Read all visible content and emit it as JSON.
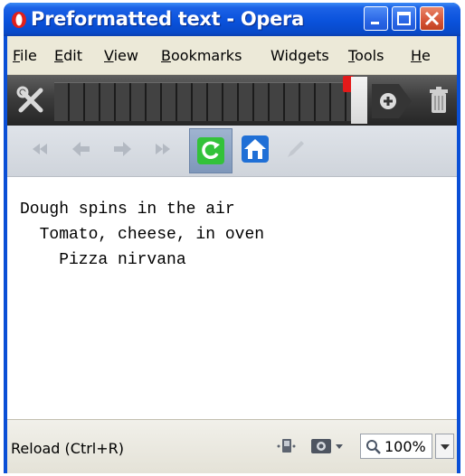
{
  "window": {
    "title": "Preformatted text - Opera"
  },
  "menu": {
    "items": [
      {
        "label": "File",
        "mnemonic": "F",
        "rest": "ile"
      },
      {
        "label": "Edit",
        "mnemonic": "E",
        "rest": "dit"
      },
      {
        "label": "View",
        "mnemonic": "V",
        "rest": "iew"
      },
      {
        "label": "Bookmarks",
        "mnemonic": "B",
        "rest": "ookmarks"
      },
      {
        "label": "Widgets",
        "mnemonic": "",
        "rest": "Widgets"
      },
      {
        "label": "Tools",
        "mnemonic": "T",
        "rest": "ools"
      },
      {
        "label": "Help",
        "mnemonic": "H",
        "rest": "e"
      }
    ]
  },
  "toolbar": {
    "icons": [
      "tools-icon",
      "tab-badge",
      "add-tab-icon",
      "trash-icon"
    ]
  },
  "nav": {
    "buttons": [
      "rewind-icon",
      "back-icon",
      "forward-icon",
      "fast-forward-icon",
      "reload-icon",
      "home-icon",
      "edit-icon"
    ]
  },
  "content": {
    "pre_text": "Dough spins in the air\n  Tomato, cheese, in oven\n    Pizza nirvana"
  },
  "status": {
    "text": "Reload (Ctrl+R)",
    "zoom": "100%"
  },
  "colors": {
    "titlebar": "#0a52dc",
    "chrome": "#ece9d8",
    "toolbar_dark": "#3c3c3c",
    "reload_green": "#33c23a",
    "home_blue": "#1f6fd6"
  }
}
